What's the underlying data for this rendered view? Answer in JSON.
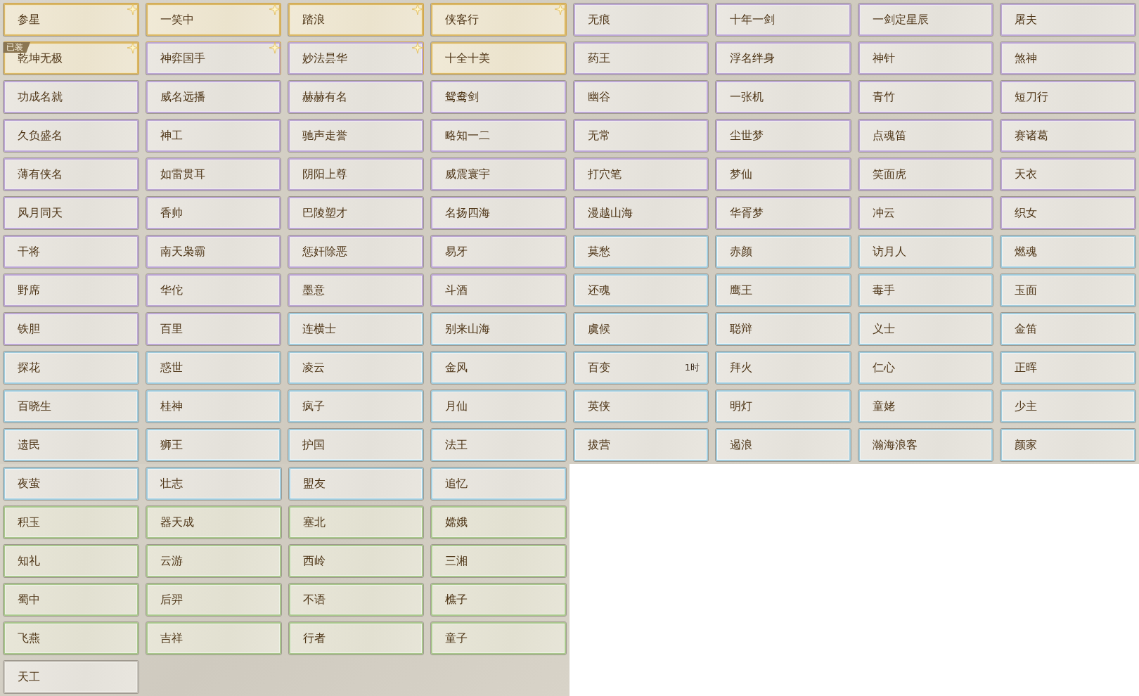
{
  "upper_grid": [
    {
      "label": "参星",
      "kind": "gold",
      "starred": true
    },
    {
      "label": "一笑中",
      "kind": "gold",
      "starred": true
    },
    {
      "label": "踏浪",
      "kind": "gold",
      "starred": true
    },
    {
      "label": "侠客行",
      "kind": "gold",
      "starred": true
    },
    {
      "label": "无痕",
      "kind": "purple",
      "starred": false
    },
    {
      "label": "十年一剑",
      "kind": "purple",
      "starred": false
    },
    {
      "label": "一剑定星辰",
      "kind": "purple",
      "starred": false
    },
    {
      "label": "屠夫",
      "kind": "purple",
      "starred": false
    },
    {
      "label": "乾坤无极",
      "kind": "gold",
      "starred": true,
      "tag": "已装"
    },
    {
      "label": "神弈国手",
      "kind": "purple",
      "starred": true
    },
    {
      "label": "妙法昙华",
      "kind": "purple",
      "starred": true
    },
    {
      "label": "十全十美",
      "kind": "gold",
      "starred": false
    },
    {
      "label": "药王",
      "kind": "purple",
      "starred": false
    },
    {
      "label": "浮名绊身",
      "kind": "purple",
      "starred": false
    },
    {
      "label": "神针",
      "kind": "purple",
      "starred": false
    },
    {
      "label": "煞神",
      "kind": "purple",
      "starred": false
    },
    {
      "label": "功成名就",
      "kind": "purple",
      "starred": false
    },
    {
      "label": "威名远播",
      "kind": "purple",
      "starred": false
    },
    {
      "label": "赫赫有名",
      "kind": "purple",
      "starred": false
    },
    {
      "label": "鸳鸯剑",
      "kind": "purple",
      "starred": false
    },
    {
      "label": "幽谷",
      "kind": "purple",
      "starred": false
    },
    {
      "label": "一张机",
      "kind": "purple",
      "starred": false
    },
    {
      "label": "青竹",
      "kind": "purple",
      "starred": false
    },
    {
      "label": "短刀行",
      "kind": "purple",
      "starred": false
    },
    {
      "label": "久负盛名",
      "kind": "purple",
      "starred": false
    },
    {
      "label": "神工",
      "kind": "purple",
      "starred": false
    },
    {
      "label": "驰声走誉",
      "kind": "purple",
      "starred": false
    },
    {
      "label": "略知一二",
      "kind": "purple",
      "starred": false
    },
    {
      "label": "无常",
      "kind": "purple",
      "starred": false
    },
    {
      "label": "尘世梦",
      "kind": "purple",
      "starred": false
    },
    {
      "label": "点魂笛",
      "kind": "purple",
      "starred": false
    },
    {
      "label": "赛诸葛",
      "kind": "purple",
      "starred": false
    },
    {
      "label": "薄有侠名",
      "kind": "purple",
      "starred": false
    },
    {
      "label": "如雷贯耳",
      "kind": "purple",
      "starred": false
    },
    {
      "label": "阴阳上尊",
      "kind": "purple",
      "starred": false
    },
    {
      "label": "威震寰宇",
      "kind": "purple",
      "starred": false
    },
    {
      "label": "打穴笔",
      "kind": "purple",
      "starred": false
    },
    {
      "label": "梦仙",
      "kind": "purple",
      "starred": false
    },
    {
      "label": "笑面虎",
      "kind": "purple",
      "starred": false
    },
    {
      "label": "天衣",
      "kind": "purple",
      "starred": false
    },
    {
      "label": "风月同天",
      "kind": "purple",
      "starred": false
    },
    {
      "label": "香帅",
      "kind": "purple",
      "starred": false
    },
    {
      "label": "巴陵塑才",
      "kind": "purple",
      "starred": false
    },
    {
      "label": "名扬四海",
      "kind": "purple",
      "starred": false
    },
    {
      "label": "漫越山海",
      "kind": "purple",
      "starred": false
    },
    {
      "label": "华胥梦",
      "kind": "purple",
      "starred": false
    },
    {
      "label": "冲云",
      "kind": "purple",
      "starred": false
    },
    {
      "label": "织女",
      "kind": "purple",
      "starred": false
    },
    {
      "label": "干将",
      "kind": "purple",
      "starred": false
    },
    {
      "label": "南天枭霸",
      "kind": "purple",
      "starred": false
    },
    {
      "label": "惩奸除恶",
      "kind": "purple",
      "starred": false
    },
    {
      "label": "易牙",
      "kind": "purple",
      "starred": false
    },
    {
      "label": "莫愁",
      "kind": "blue",
      "starred": false
    },
    {
      "label": "赤颜",
      "kind": "blue",
      "starred": false
    },
    {
      "label": "访月人",
      "kind": "blue",
      "starred": false
    },
    {
      "label": "燃魂",
      "kind": "blue",
      "starred": false
    },
    {
      "label": "野席",
      "kind": "purple",
      "starred": false
    },
    {
      "label": "华佗",
      "kind": "purple",
      "starred": false
    },
    {
      "label": "墨意",
      "kind": "purple",
      "starred": false
    },
    {
      "label": "斗酒",
      "kind": "purple",
      "starred": false
    },
    {
      "label": "还魂",
      "kind": "blue",
      "starred": false
    },
    {
      "label": "鹰王",
      "kind": "blue",
      "starred": false
    },
    {
      "label": "毒手",
      "kind": "blue",
      "starred": false
    },
    {
      "label": "玉面",
      "kind": "blue",
      "starred": false
    },
    {
      "label": "铁胆",
      "kind": "purple",
      "starred": false
    },
    {
      "label": "百里",
      "kind": "purple",
      "starred": false
    },
    {
      "label": "连横士",
      "kind": "blue",
      "starred": false
    },
    {
      "label": "别来山海",
      "kind": "blue",
      "starred": false
    },
    {
      "label": "虞候",
      "kind": "blue",
      "starred": false
    },
    {
      "label": "聪辩",
      "kind": "blue",
      "starred": false
    },
    {
      "label": "义士",
      "kind": "blue",
      "starred": false
    },
    {
      "label": "金笛",
      "kind": "blue",
      "starred": false
    },
    {
      "label": "探花",
      "kind": "blue",
      "starred": false
    },
    {
      "label": "惑世",
      "kind": "blue",
      "starred": false
    },
    {
      "label": "凌云",
      "kind": "blue",
      "starred": false
    },
    {
      "label": "金风",
      "kind": "blue",
      "starred": false
    },
    {
      "label": "百变",
      "kind": "blue",
      "starred": false,
      "timer": "1时"
    },
    {
      "label": "拜火",
      "kind": "blue",
      "starred": false
    },
    {
      "label": "仁心",
      "kind": "blue",
      "starred": false
    },
    {
      "label": "正晖",
      "kind": "blue",
      "starred": false
    },
    {
      "label": "百晓生",
      "kind": "blue",
      "starred": false
    },
    {
      "label": "桂神",
      "kind": "blue",
      "starred": false
    },
    {
      "label": "疯子",
      "kind": "blue",
      "starred": false
    },
    {
      "label": "月仙",
      "kind": "blue",
      "starred": false
    },
    {
      "label": "英侠",
      "kind": "blue",
      "starred": false
    },
    {
      "label": "明灯",
      "kind": "blue",
      "starred": false
    },
    {
      "label": "童姥",
      "kind": "blue",
      "starred": false
    },
    {
      "label": "少主",
      "kind": "blue",
      "starred": false
    },
    {
      "label": "遗民",
      "kind": "blue",
      "starred": false
    },
    {
      "label": "狮王",
      "kind": "blue",
      "starred": false
    },
    {
      "label": "护国",
      "kind": "blue",
      "starred": false
    },
    {
      "label": "法王",
      "kind": "blue",
      "starred": false
    },
    {
      "label": "拔营",
      "kind": "blue",
      "starred": false
    },
    {
      "label": "遏浪",
      "kind": "blue",
      "starred": false
    },
    {
      "label": "瀚海浪客",
      "kind": "blue",
      "starred": false
    },
    {
      "label": "颜家",
      "kind": "blue",
      "starred": false
    }
  ],
  "lower_grid": [
    {
      "label": "夜萤",
      "kind": "blue",
      "starred": false
    },
    {
      "label": "壮志",
      "kind": "blue",
      "starred": false
    },
    {
      "label": "盟友",
      "kind": "blue",
      "starred": false
    },
    {
      "label": "追忆",
      "kind": "blue",
      "starred": false
    },
    {
      "label": "积玉",
      "kind": "green",
      "starred": false
    },
    {
      "label": "器天成",
      "kind": "green",
      "starred": false
    },
    {
      "label": "塞北",
      "kind": "green",
      "starred": false
    },
    {
      "label": "嫦娥",
      "kind": "green",
      "starred": false
    },
    {
      "label": "知礼",
      "kind": "green",
      "starred": false
    },
    {
      "label": "云游",
      "kind": "green",
      "starred": false
    },
    {
      "label": "西岭",
      "kind": "green",
      "starred": false
    },
    {
      "label": "三湘",
      "kind": "green",
      "starred": false
    },
    {
      "label": "蜀中",
      "kind": "green",
      "starred": false
    },
    {
      "label": "后羿",
      "kind": "green",
      "starred": false
    },
    {
      "label": "不语",
      "kind": "green",
      "starred": false
    },
    {
      "label": "樵子",
      "kind": "green",
      "starred": false
    },
    {
      "label": "飞燕",
      "kind": "green",
      "starred": false
    },
    {
      "label": "吉祥",
      "kind": "green",
      "starred": false
    },
    {
      "label": "行者",
      "kind": "green",
      "starred": false
    },
    {
      "label": "童子",
      "kind": "green",
      "starred": false
    },
    {
      "label": "天工",
      "kind": "plain",
      "starred": false
    }
  ]
}
